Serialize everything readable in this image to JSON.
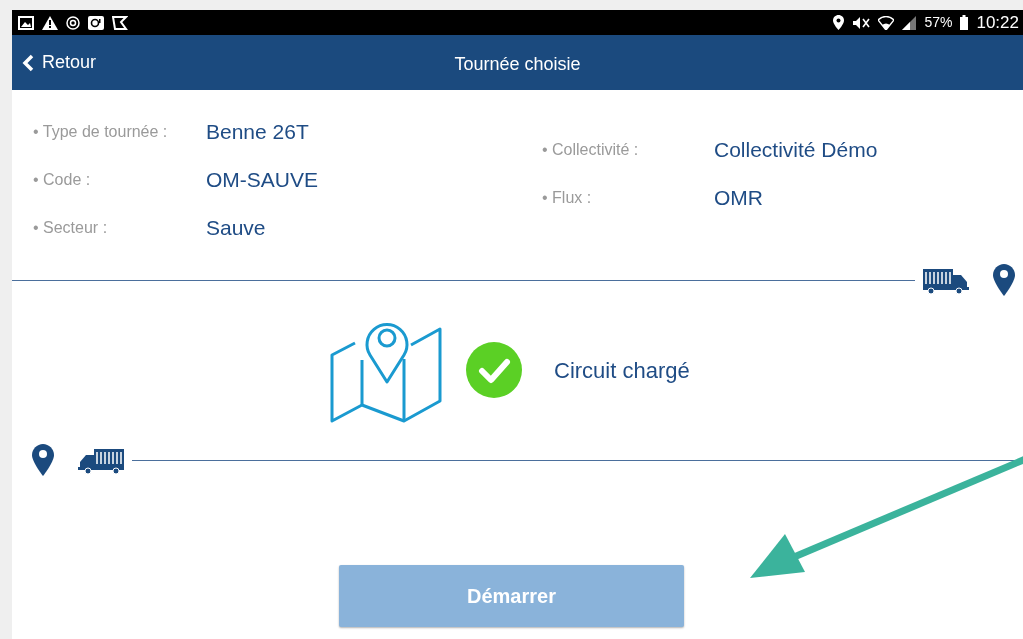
{
  "status_bar": {
    "battery": "57%",
    "time": "10:22"
  },
  "header": {
    "back": "Retour",
    "title": "Tournée choisie"
  },
  "details_left": [
    {
      "label": "• Type de tournée :",
      "value": "Benne 26T"
    },
    {
      "label": "• Code :",
      "value": "OM-SAUVE"
    },
    {
      "label": "• Secteur :",
      "value": "Sauve"
    }
  ],
  "details_right": [
    {
      "label": "• Collectivité :",
      "value": "Collectivité Démo"
    },
    {
      "label": "• Flux :",
      "value": "OMR"
    }
  ],
  "status": {
    "text": "Circuit chargé",
    "loaded": true
  },
  "start_button": {
    "label": "Démarrer",
    "disabled": true
  }
}
